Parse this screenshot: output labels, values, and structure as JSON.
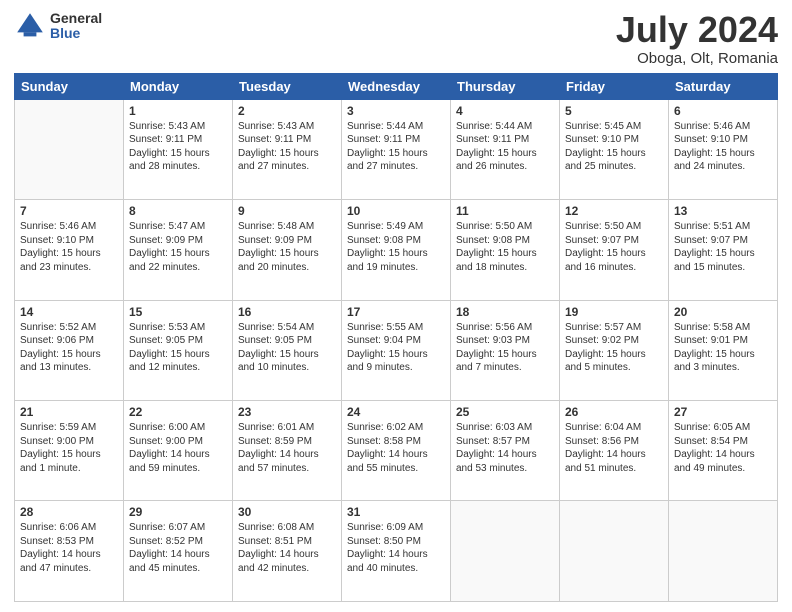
{
  "logo": {
    "general": "General",
    "blue": "Blue"
  },
  "title": "July 2024",
  "subtitle": "Oboga, Olt, Romania",
  "weekdays": [
    "Sunday",
    "Monday",
    "Tuesday",
    "Wednesday",
    "Thursday",
    "Friday",
    "Saturday"
  ],
  "weeks": [
    [
      {
        "day": "",
        "info": ""
      },
      {
        "day": "1",
        "info": "Sunrise: 5:43 AM\nSunset: 9:11 PM\nDaylight: 15 hours\nand 28 minutes."
      },
      {
        "day": "2",
        "info": "Sunrise: 5:43 AM\nSunset: 9:11 PM\nDaylight: 15 hours\nand 27 minutes."
      },
      {
        "day": "3",
        "info": "Sunrise: 5:44 AM\nSunset: 9:11 PM\nDaylight: 15 hours\nand 27 minutes."
      },
      {
        "day": "4",
        "info": "Sunrise: 5:44 AM\nSunset: 9:11 PM\nDaylight: 15 hours\nand 26 minutes."
      },
      {
        "day": "5",
        "info": "Sunrise: 5:45 AM\nSunset: 9:10 PM\nDaylight: 15 hours\nand 25 minutes."
      },
      {
        "day": "6",
        "info": "Sunrise: 5:46 AM\nSunset: 9:10 PM\nDaylight: 15 hours\nand 24 minutes."
      }
    ],
    [
      {
        "day": "7",
        "info": "Sunrise: 5:46 AM\nSunset: 9:10 PM\nDaylight: 15 hours\nand 23 minutes."
      },
      {
        "day": "8",
        "info": "Sunrise: 5:47 AM\nSunset: 9:09 PM\nDaylight: 15 hours\nand 22 minutes."
      },
      {
        "day": "9",
        "info": "Sunrise: 5:48 AM\nSunset: 9:09 PM\nDaylight: 15 hours\nand 20 minutes."
      },
      {
        "day": "10",
        "info": "Sunrise: 5:49 AM\nSunset: 9:08 PM\nDaylight: 15 hours\nand 19 minutes."
      },
      {
        "day": "11",
        "info": "Sunrise: 5:50 AM\nSunset: 9:08 PM\nDaylight: 15 hours\nand 18 minutes."
      },
      {
        "day": "12",
        "info": "Sunrise: 5:50 AM\nSunset: 9:07 PM\nDaylight: 15 hours\nand 16 minutes."
      },
      {
        "day": "13",
        "info": "Sunrise: 5:51 AM\nSunset: 9:07 PM\nDaylight: 15 hours\nand 15 minutes."
      }
    ],
    [
      {
        "day": "14",
        "info": "Sunrise: 5:52 AM\nSunset: 9:06 PM\nDaylight: 15 hours\nand 13 minutes."
      },
      {
        "day": "15",
        "info": "Sunrise: 5:53 AM\nSunset: 9:05 PM\nDaylight: 15 hours\nand 12 minutes."
      },
      {
        "day": "16",
        "info": "Sunrise: 5:54 AM\nSunset: 9:05 PM\nDaylight: 15 hours\nand 10 minutes."
      },
      {
        "day": "17",
        "info": "Sunrise: 5:55 AM\nSunset: 9:04 PM\nDaylight: 15 hours\nand 9 minutes."
      },
      {
        "day": "18",
        "info": "Sunrise: 5:56 AM\nSunset: 9:03 PM\nDaylight: 15 hours\nand 7 minutes."
      },
      {
        "day": "19",
        "info": "Sunrise: 5:57 AM\nSunset: 9:02 PM\nDaylight: 15 hours\nand 5 minutes."
      },
      {
        "day": "20",
        "info": "Sunrise: 5:58 AM\nSunset: 9:01 PM\nDaylight: 15 hours\nand 3 minutes."
      }
    ],
    [
      {
        "day": "21",
        "info": "Sunrise: 5:59 AM\nSunset: 9:00 PM\nDaylight: 15 hours\nand 1 minute."
      },
      {
        "day": "22",
        "info": "Sunrise: 6:00 AM\nSunset: 9:00 PM\nDaylight: 14 hours\nand 59 minutes."
      },
      {
        "day": "23",
        "info": "Sunrise: 6:01 AM\nSunset: 8:59 PM\nDaylight: 14 hours\nand 57 minutes."
      },
      {
        "day": "24",
        "info": "Sunrise: 6:02 AM\nSunset: 8:58 PM\nDaylight: 14 hours\nand 55 minutes."
      },
      {
        "day": "25",
        "info": "Sunrise: 6:03 AM\nSunset: 8:57 PM\nDaylight: 14 hours\nand 53 minutes."
      },
      {
        "day": "26",
        "info": "Sunrise: 6:04 AM\nSunset: 8:56 PM\nDaylight: 14 hours\nand 51 minutes."
      },
      {
        "day": "27",
        "info": "Sunrise: 6:05 AM\nSunset: 8:54 PM\nDaylight: 14 hours\nand 49 minutes."
      }
    ],
    [
      {
        "day": "28",
        "info": "Sunrise: 6:06 AM\nSunset: 8:53 PM\nDaylight: 14 hours\nand 47 minutes."
      },
      {
        "day": "29",
        "info": "Sunrise: 6:07 AM\nSunset: 8:52 PM\nDaylight: 14 hours\nand 45 minutes."
      },
      {
        "day": "30",
        "info": "Sunrise: 6:08 AM\nSunset: 8:51 PM\nDaylight: 14 hours\nand 42 minutes."
      },
      {
        "day": "31",
        "info": "Sunrise: 6:09 AM\nSunset: 8:50 PM\nDaylight: 14 hours\nand 40 minutes."
      },
      {
        "day": "",
        "info": ""
      },
      {
        "day": "",
        "info": ""
      },
      {
        "day": "",
        "info": ""
      }
    ]
  ]
}
